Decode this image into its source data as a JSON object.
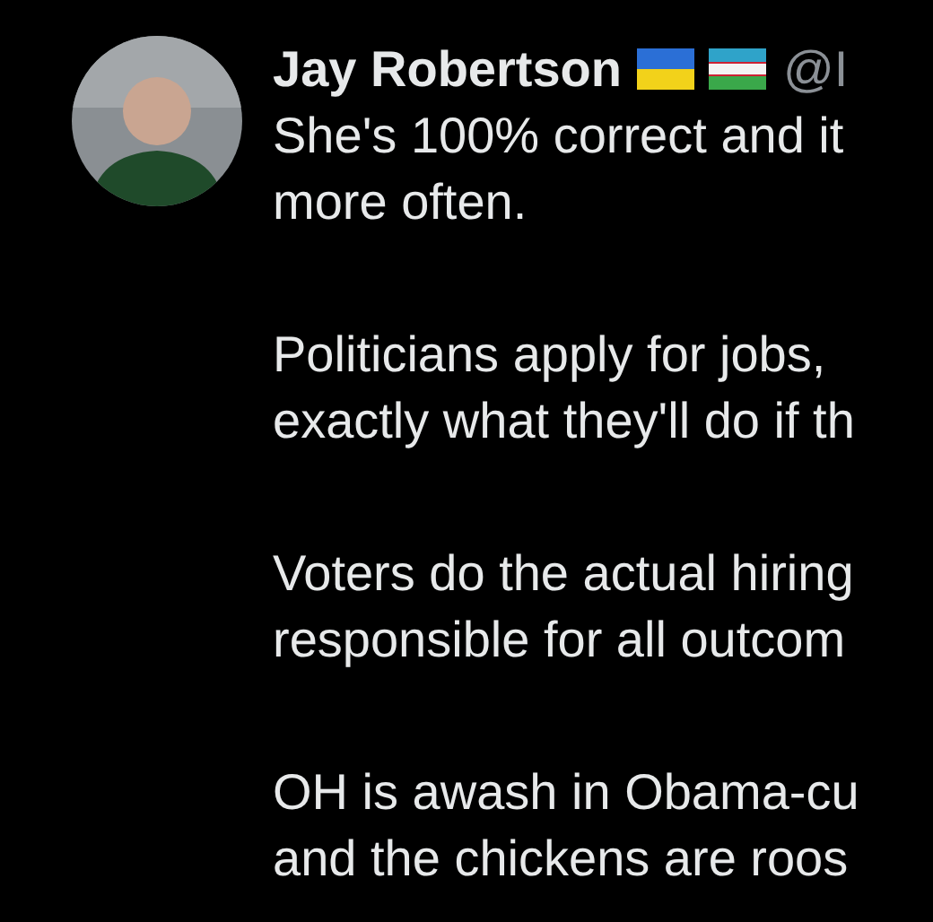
{
  "post": {
    "author": "Jay Robertson",
    "handle": "@I",
    "paragraphs": [
      {
        "lines": [
          "She's 100% correct and it",
          "more often."
        ]
      },
      {
        "lines": [
          "Politicians apply for jobs,",
          "exactly what they'll do if th"
        ]
      },
      {
        "lines": [
          "Voters do the actual hiring",
          "responsible for all outcom"
        ]
      },
      {
        "lines": [
          "OH is awash in Obama-cu",
          "and the chickens are roos"
        ]
      }
    ]
  }
}
